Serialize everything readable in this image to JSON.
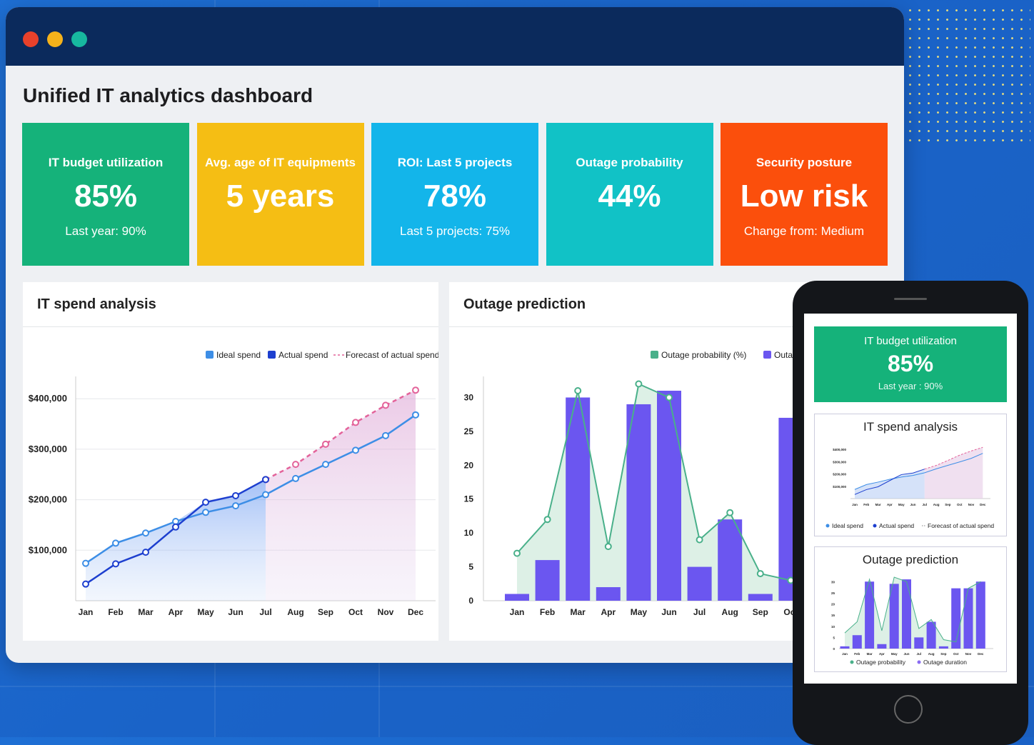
{
  "dashboard": {
    "title": "Unified IT analytics dashboard"
  },
  "traffic_lights": [
    "#e8412b",
    "#f5b21b",
    "#17b89f"
  ],
  "kpis": [
    {
      "label": "IT budget utilization",
      "value": "85%",
      "sub": "Last year: 90%",
      "color": "#15b27a"
    },
    {
      "label": "Avg. age of IT equipments",
      "value": "5 years",
      "sub": "",
      "color": "#f5be14"
    },
    {
      "label": "ROI: Last 5 projects",
      "value": "78%",
      "sub": "Last 5 projects: 75%",
      "color": "#13b5ea"
    },
    {
      "label": "Outage probability",
      "value": "44%",
      "sub": "",
      "color": "#11c2c6"
    },
    {
      "label": "Security posture",
      "value": "Low risk",
      "sub": "Change from: Medium",
      "color": "#fb4f0c"
    }
  ],
  "spend_panel": {
    "title": "IT spend analysis",
    "legend": [
      "Ideal spend",
      "Actual spend",
      "Forecast of actual spend"
    ]
  },
  "outage_panel": {
    "title": "Outage prediction",
    "legend": [
      "Outage probability (%)",
      "Outag"
    ]
  },
  "chart_data": [
    {
      "type": "line",
      "title": "IT spend analysis",
      "x": [
        "Jan",
        "Feb",
        "Mar",
        "Apr",
        "May",
        "Jun",
        "Jul",
        "Aug",
        "Sep",
        "Oct",
        "Nov",
        "Dec"
      ],
      "yticks": [
        "$100,000",
        "$200,000",
        "$300,000",
        "$400,000"
      ],
      "ylim": [
        0,
        430000
      ],
      "series": [
        {
          "name": "Ideal spend",
          "color": "#3d8ee6",
          "values": [
            74000,
            114000,
            134000,
            157000,
            175000,
            188000,
            210000,
            242000,
            270000,
            298000,
            327000,
            368000
          ]
        },
        {
          "name": "Actual spend",
          "color": "#1d3fcf",
          "values": [
            33000,
            73000,
            96000,
            146000,
            195000,
            208000,
            240000,
            null,
            null,
            null,
            null,
            null
          ]
        },
        {
          "name": "Forecast of actual spend",
          "color": "#e3639a",
          "values": [
            null,
            null,
            null,
            null,
            null,
            null,
            240000,
            270000,
            310000,
            353000,
            387000,
            417000
          ]
        }
      ],
      "legend_position": "top-right",
      "grid": true
    },
    {
      "type": "bar",
      "title": "Outage prediction",
      "categories": [
        "Jan",
        "Feb",
        "Mar",
        "Apr",
        "May",
        "Jun",
        "Jul",
        "Aug",
        "Sep",
        "Oct"
      ],
      "yticks": [
        "0",
        "5",
        "10",
        "15",
        "20",
        "25",
        "30"
      ],
      "ylim": [
        0,
        32
      ],
      "series": [
        {
          "name": "Outage probability (%)",
          "type": "area",
          "color": "#49b08a",
          "values": [
            7,
            12,
            31,
            8,
            32,
            30,
            9,
            13,
            4,
            3
          ]
        },
        {
          "name": "Outag",
          "type": "bar",
          "color": "#6b56f0",
          "values": [
            1,
            6,
            30,
            2,
            29,
            31,
            5,
            12,
            1,
            27
          ]
        }
      ],
      "legend_position": "top-right",
      "grid": false
    }
  ],
  "mobile": {
    "kpi": {
      "label": "IT budget utilization",
      "value": "85%",
      "sub": "Last year : 90%"
    },
    "spend_title": "IT spend analysis",
    "spend_legend": [
      "Ideal spend",
      "Actual spend",
      "Forecast of actual spend"
    ],
    "spend_yticks": [
      "$400,000",
      "$300,000",
      "$200,000",
      "$100,000"
    ],
    "months": [
      "Jan",
      "Feb",
      "Mar",
      "Apr",
      "May",
      "Jun",
      "Jul",
      "Aug",
      "Sep",
      "Oct",
      "Nov",
      "Dec"
    ],
    "outage_title": "Outage prediction",
    "outage_legend": [
      "Outage probability",
      "Outage duration"
    ],
    "outage_yticks": [
      "30",
      "25",
      "20",
      "15",
      "10",
      "5",
      "0"
    ],
    "outage_bars": [
      1,
      6,
      30,
      2,
      29,
      31,
      5,
      12,
      1,
      27,
      27,
      30
    ],
    "outage_line": [
      7,
      12,
      31,
      8,
      32,
      30,
      9,
      13,
      4,
      3,
      27,
      30
    ]
  }
}
